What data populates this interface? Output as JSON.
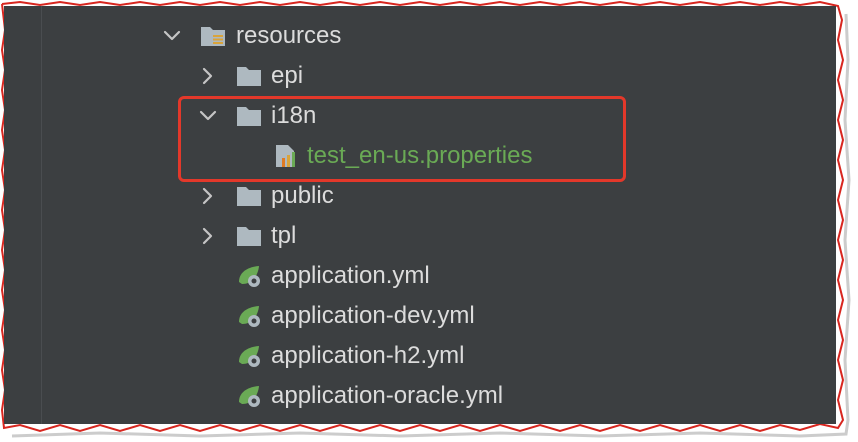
{
  "tree": {
    "items": [
      {
        "label": "resources",
        "kind": "folder-resources",
        "expanded": true,
        "depth": 0,
        "color": "default"
      },
      {
        "label": "epi",
        "kind": "folder",
        "expanded": false,
        "depth": 1,
        "color": "default"
      },
      {
        "label": "i18n",
        "kind": "folder",
        "expanded": true,
        "depth": 1,
        "color": "default"
      },
      {
        "label": "test_en-us.properties",
        "kind": "properties-file",
        "depth": 2,
        "color": "green"
      },
      {
        "label": "public",
        "kind": "folder",
        "expanded": false,
        "depth": 1,
        "color": "default"
      },
      {
        "label": "tpl",
        "kind": "folder",
        "expanded": false,
        "depth": 1,
        "color": "default"
      },
      {
        "label": "application.yml",
        "kind": "spring-yml",
        "depth": 1,
        "color": "default"
      },
      {
        "label": "application-dev.yml",
        "kind": "spring-yml",
        "depth": 1,
        "color": "default"
      },
      {
        "label": "application-h2.yml",
        "kind": "spring-yml",
        "depth": 1,
        "color": "default"
      },
      {
        "label": "application-oracle.yml",
        "kind": "spring-yml",
        "depth": 1,
        "color": "default"
      }
    ]
  },
  "colors": {
    "background": "#3c3f41",
    "text": "#dcdcdc",
    "green_text": "#6aaa55",
    "highlight_border": "#e3382a",
    "folder": "#aeb9c0"
  }
}
